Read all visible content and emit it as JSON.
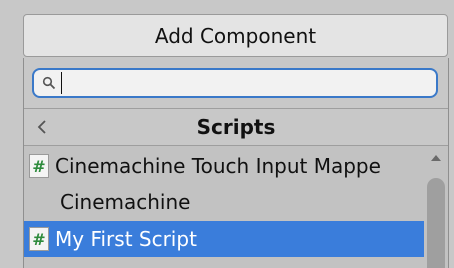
{
  "add_component": {
    "label": "Add Component"
  },
  "search": {
    "value": "",
    "placeholder": ""
  },
  "header": {
    "title": "Scripts"
  },
  "list": {
    "items": [
      {
        "label": "Cinemachine Touch Input Mappe",
        "icon": "hash-script-icon",
        "selected": false
      },
      {
        "label": "Cinemachine",
        "icon": "",
        "selected": false
      },
      {
        "label": "My First Script",
        "icon": "hash-script-icon",
        "selected": true
      }
    ]
  },
  "icons": {
    "script_glyph": "#"
  },
  "colors": {
    "selection": "#3a7ddb",
    "search_focus": "#3a79c9",
    "script_icon": "#2e8b3d"
  }
}
